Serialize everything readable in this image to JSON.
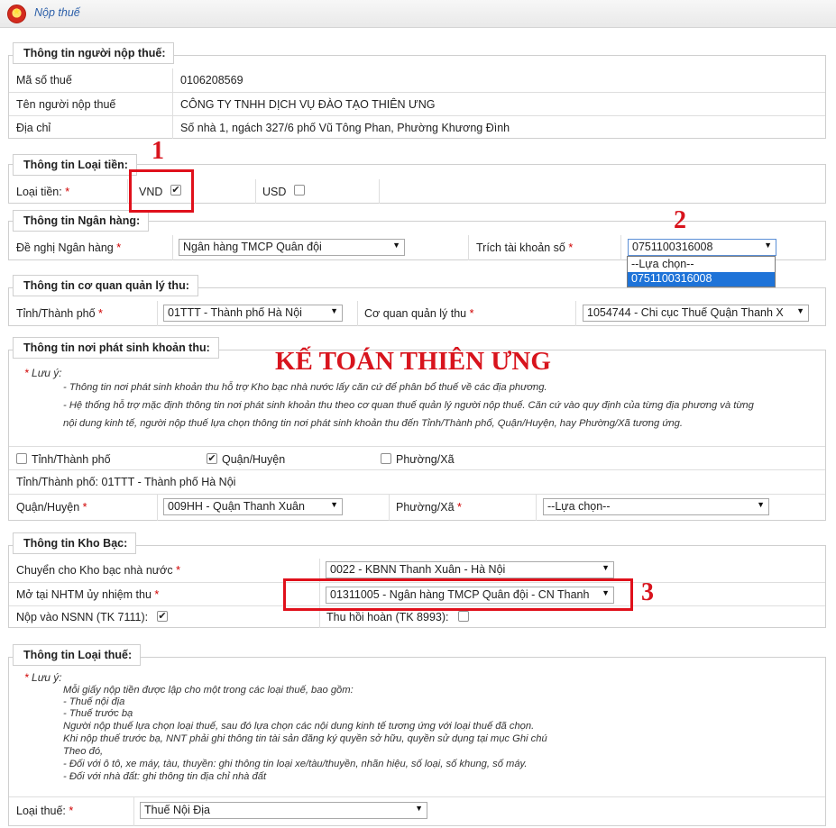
{
  "header": {
    "title": "Nộp thuế",
    "emblem_icon": "national-emblem-icon"
  },
  "taxpayer": {
    "legend": "Thông tin người nộp thuế:",
    "tax_code_label": "Mã số thuế",
    "tax_code_value": "0106208569",
    "name_label": "Tên người nộp thuế",
    "name_value": "CÔNG TY TNHH DỊCH VỤ ĐÀO TẠO THIÊN ƯNG",
    "address_label": "Địa chỉ",
    "address_value": "Số nhà 1, ngách 327/6 phố Vũ Tông Phan, Phường Khương Đình"
  },
  "currency": {
    "legend": "Thông tin Loại tiền:",
    "label": "Loại tiền:",
    "required": "*",
    "vnd_label": "VND",
    "vnd_checked": true,
    "usd_label": "USD",
    "usd_checked": false
  },
  "bank": {
    "legend": "Thông tin Ngân hàng:",
    "bank_label": "Đề nghị Ngân hàng",
    "required": "*",
    "bank_value": "Ngân hàng TMCP Quân đội",
    "account_label": "Trích tài khoản số",
    "account_value": "0751100316008",
    "account_options": [
      "--Lựa chọn--",
      "0751100316008"
    ]
  },
  "authority": {
    "legend": "Thông tin cơ quan quản lý thu:",
    "province_label": "Tỉnh/Thành phố",
    "required": "*",
    "province_value": "01TTT - Thành phố Hà Nội",
    "agency_label": "Cơ quan quản lý thu",
    "agency_value": "1054744 - Chi cục Thuế Quận Thanh X"
  },
  "revenue_origin": {
    "legend": "Thông tin nơi phát sinh khoản thu:",
    "note_title": "Lưu ý:",
    "note_lines": [
      "- Thông tin nơi phát sinh khoản thu hỗ trợ Kho bạc nhà nước lấy căn cứ để phân bổ thuế về các địa phương.",
      "- Hệ thống hỗ trợ mặc định thông tin nơi phát sinh khoản thu theo cơ quan thuế quản lý người nộp thuế. Căn cứ vào quy định của từng địa phương và từng",
      "nội dung kinh tế, người nộp thuế lựa chọn thông tin nơi phát sinh khoản thu đến Tỉnh/Thành phố, Quận/Huyện, hay Phường/Xã tương ứng."
    ],
    "opt_province": "Tỉnh/Thành phố",
    "opt_province_checked": false,
    "opt_district": "Quận/Huyện",
    "opt_district_checked": true,
    "opt_ward": "Phường/Xã",
    "opt_ward_checked": false,
    "province_text": "Tỉnh/Thành phố: 01TTT - Thành phố Hà Nội",
    "district_label": "Quận/Huyện",
    "district_value": "009HH - Quận Thanh Xuân",
    "ward_label": "Phường/Xã",
    "ward_value": "--Lựa chọn--",
    "required": "*"
  },
  "treasury": {
    "legend": "Thông tin Kho Bạc:",
    "transfer_label": "Chuyển cho Kho bạc nhà nước",
    "transfer_value": "0022 - KBNN Thanh Xuân - Hà Nội",
    "bank_label": "Mở tại NHTM ủy nhiệm thu",
    "bank_value": "01311005 - Ngân hàng TMCP Quân đội - CN Thanh",
    "nsnn_label": "Nộp vào NSNN (TK 7111):",
    "nsnn_checked": true,
    "refund_label": "Thu hồi hoàn (TK 8993):",
    "refund_checked": false,
    "required": "*"
  },
  "tax_type": {
    "legend": "Thông tin Loại thuế:",
    "note_title": "Lưu ý:",
    "note_lines": [
      "Mỗi giấy nộp tiền được lập cho một trong các loại thuế, bao gồm:",
      "- Thuế nội địa",
      "- Thuế trước bạ",
      "Người nộp thuế lựa chọn loại thuế, sau đó lựa chọn các nội dung kinh tế tương ứng với loại thuế đã chọn.",
      "Khi nộp thuế trước bạ, NNT phải ghi thông tin tài sản đăng ký quyền sở hữu, quyền sử dụng tại mục Ghi chú",
      "Theo đó,",
      "- Đối với ô tô, xe máy, tàu, thuyền: ghi thông tin loại xe/tàu/thuyền, nhãn hiệu, số loại, số khung, số máy.",
      "- Đối với nhà đất: ghi thông tin địa chỉ nhà đất"
    ],
    "label": "Loại thuế:",
    "required": "*",
    "value": "Thuế Nội Địa"
  },
  "annotations": {
    "watermark": "KẾ TOÁN THIÊN ƯNG",
    "marker_1": "1",
    "marker_2": "2",
    "marker_3": "3",
    "highlight_color": "#e0101b"
  }
}
